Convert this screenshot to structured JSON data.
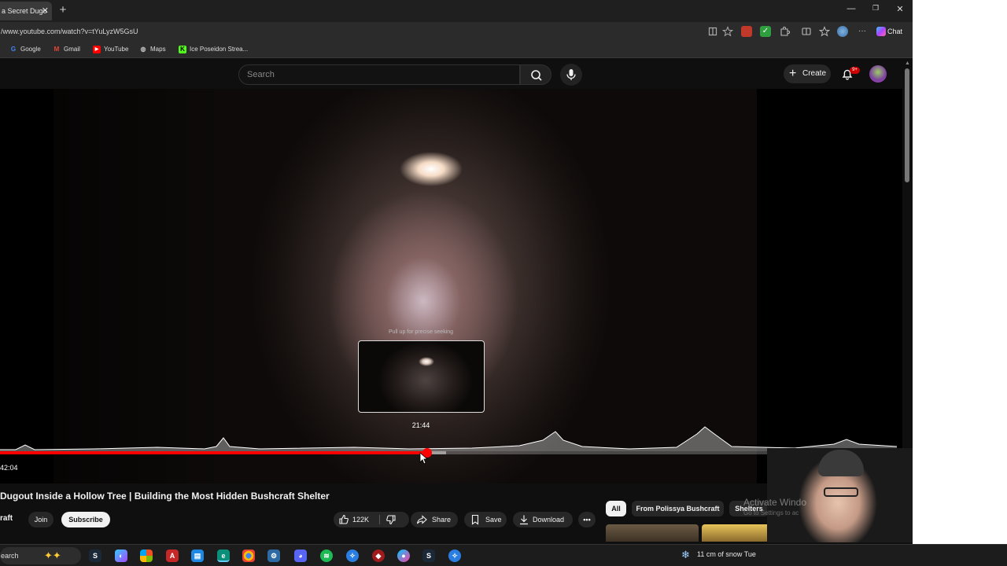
{
  "browser": {
    "tab_title": "a Secret Dugo",
    "tab_close": "✕",
    "new_tab": "+",
    "window_controls": {
      "minimize": "—",
      "restore": "❐",
      "close": "✕"
    },
    "url": "/www.youtube.com/watch?v=tYuLyzW5GsU",
    "chat_label": "Chat",
    "bookmarks": [
      {
        "label": "Google",
        "icon": "google-icon",
        "color": "#4285f4"
      },
      {
        "label": "Gmail",
        "icon": "gmail-icon",
        "color": "#ea4335"
      },
      {
        "label": "YouTube",
        "icon": "youtube-icon",
        "color": "#ff0000"
      },
      {
        "label": "Maps",
        "icon": "globe-icon",
        "color": "#bbbbbb"
      },
      {
        "label": "Ice Poseidon Strea...",
        "icon": "kick-icon",
        "color": "#53fc18"
      }
    ]
  },
  "youtube": {
    "search_placeholder": "Search",
    "create_label": "Create",
    "notification_badge": "9+"
  },
  "player": {
    "precise_hint": "Pull up for precise seeking",
    "preview_time": "21:44",
    "current_time": "42:04",
    "progress_fraction": 0.476,
    "buffered_fraction": 0.497
  },
  "video": {
    "title": "Dugout Inside a Hollow Tree | Building the Most Hidden Bushcraft Shelter",
    "channel": "raft",
    "join_label": "Join",
    "subscribe_label": "Subscribe",
    "like_count": "122K",
    "share_label": "Share",
    "save_label": "Save",
    "download_label": "Download",
    "more_label": "•••"
  },
  "recommendations": {
    "chips": [
      "All",
      "From Polissya Bushcraft",
      "Shelters"
    ]
  },
  "windows_watermark": {
    "title": "Activate Windo",
    "subtitle": "Go to Settings to ac"
  },
  "taskbar": {
    "search_label": "earch",
    "weather": "11 cm of snow Tue",
    "accent": "#1c1c1c"
  }
}
